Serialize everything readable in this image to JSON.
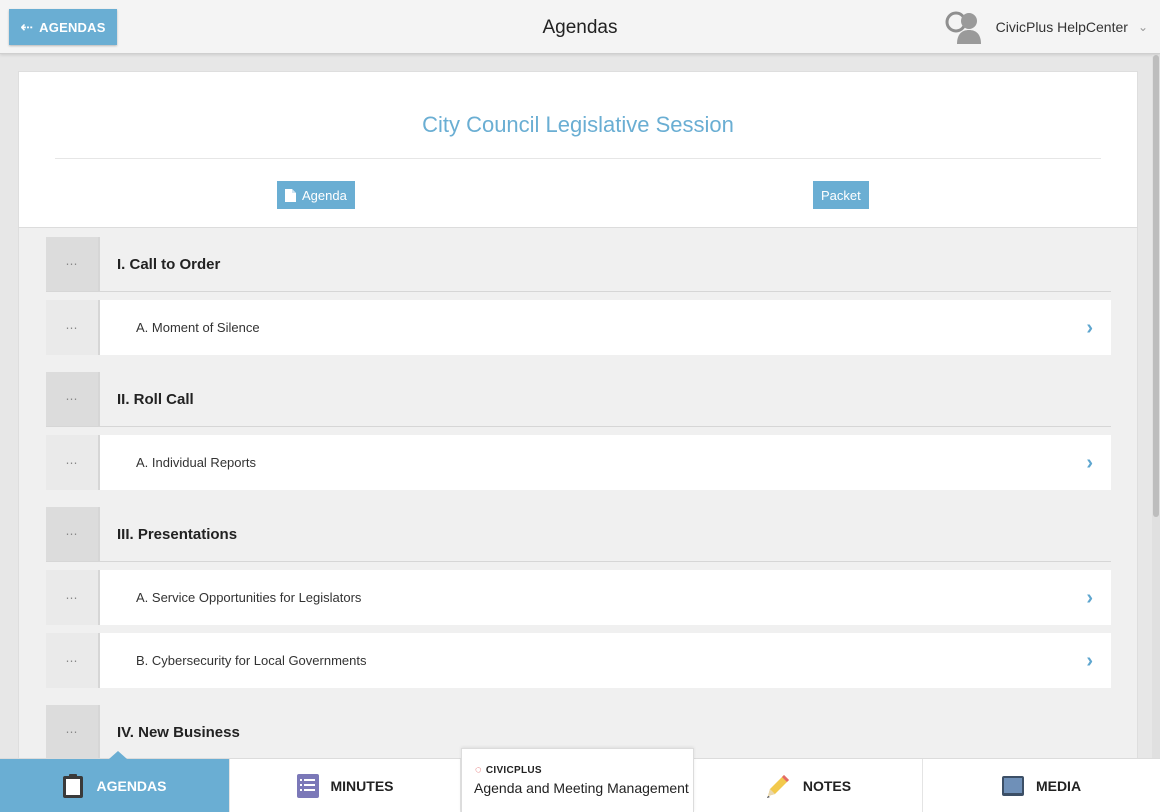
{
  "header": {
    "back_label": "AGENDAS",
    "title": "Agendas",
    "user_name": "CivicPlus HelpCenter"
  },
  "meeting": {
    "title": "City Council Legislative Session",
    "agenda_button": "Agenda",
    "packet_button": "Packet"
  },
  "agenda_items": [
    {
      "kind": "section",
      "label": "I. Call to Order"
    },
    {
      "kind": "item",
      "label": "A. Moment of Silence"
    },
    {
      "kind": "section",
      "label": "II. Roll Call"
    },
    {
      "kind": "item",
      "label": "A. Individual Reports"
    },
    {
      "kind": "section",
      "label": "III. Presentations"
    },
    {
      "kind": "item",
      "label": "A. Service Opportunities for Legislators"
    },
    {
      "kind": "item",
      "label": "B. Cybersecurity for Local Governments"
    },
    {
      "kind": "section",
      "label": "IV. New Business"
    }
  ],
  "bottom_nav": {
    "agendas": "AGENDAS",
    "minutes": "MINUTES",
    "brand_logo": "CIVICPLUS",
    "brand_sub": "Agenda and Meeting Management",
    "notes": "NOTES",
    "media": "MEDIA"
  },
  "colors": {
    "accent": "#6aaed3",
    "brand_red": "#d22b2b"
  }
}
